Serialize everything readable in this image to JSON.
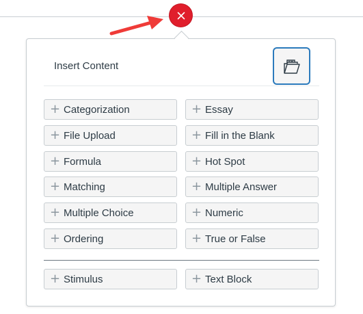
{
  "panel": {
    "title": "Insert Content",
    "plus_glyph": "+",
    "close_icon": "close-icon",
    "bank_icon": "question-bank-icon"
  },
  "question_types": [
    {
      "label": "Categorization"
    },
    {
      "label": "Essay"
    },
    {
      "label": "File Upload"
    },
    {
      "label": "Fill in the Blank"
    },
    {
      "label": "Formula"
    },
    {
      "label": "Hot Spot"
    },
    {
      "label": "Matching"
    },
    {
      "label": "Multiple Answer"
    },
    {
      "label": "Multiple Choice"
    },
    {
      "label": "Numeric"
    },
    {
      "label": "Ordering"
    },
    {
      "label": "True or False"
    }
  ],
  "content_types": [
    {
      "label": "Stimulus"
    },
    {
      "label": "Text Block"
    }
  ],
  "colors": {
    "close_button": "#e01e2c",
    "annotation_arrow": "#ef3b38",
    "focus_border": "#2b7abc",
    "option_background": "#f5f5f5"
  }
}
